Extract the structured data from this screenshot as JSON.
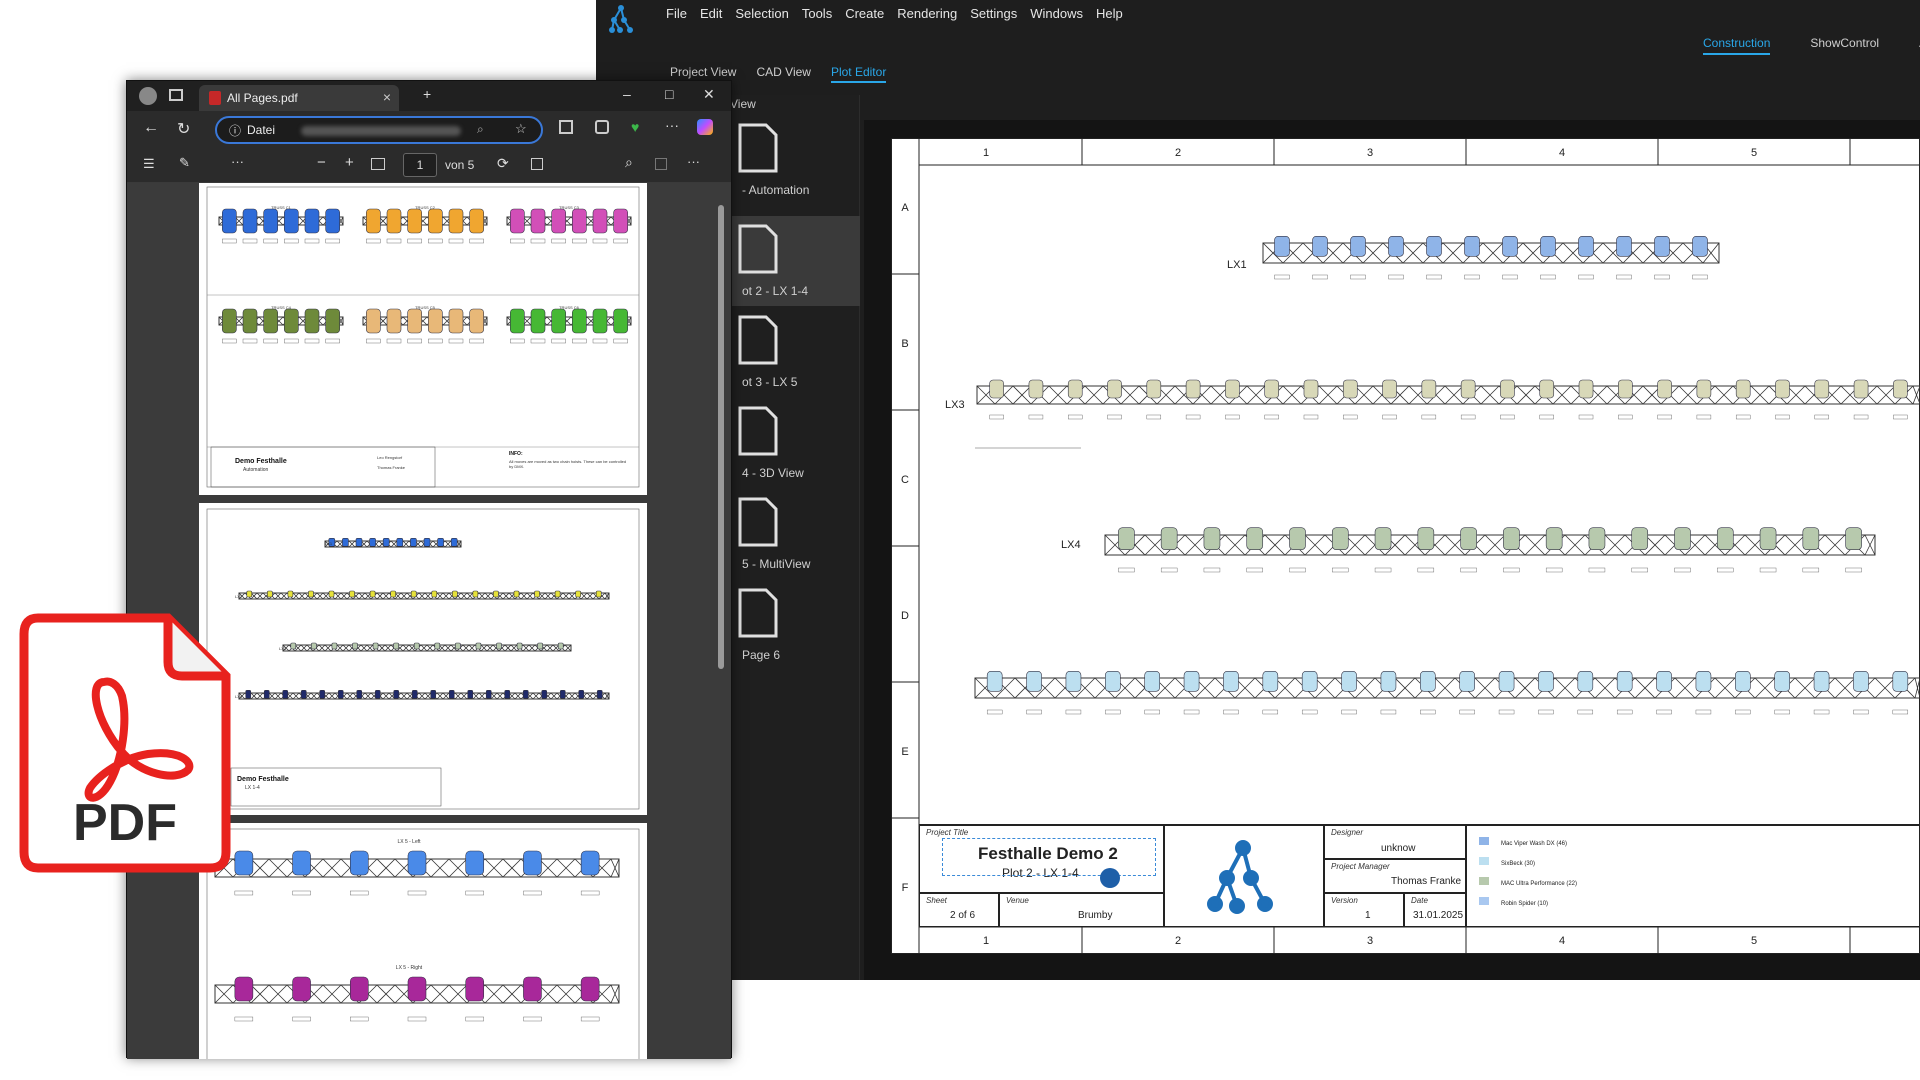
{
  "app": {
    "menu": [
      "File",
      "Edit",
      "Selection",
      "Tools",
      "Create",
      "Rendering",
      "Settings",
      "Windows",
      "Help"
    ],
    "mode_tabs": [
      "Construction",
      "ShowControl",
      "An"
    ],
    "active_mode": "Construction",
    "view_tabs": [
      "Project View",
      "CAD View",
      "Plot Editor"
    ],
    "active_view": "Plot Editor",
    "page_list_header": "View",
    "pages": [
      "- Automation",
      "ot 2 - LX 1-4",
      "ot 3 - LX 5",
      "4 - 3D View",
      "5 - MultiView",
      "Page 6"
    ],
    "selected_page": "ot 2 - LX 1-4"
  },
  "sheet": {
    "columns": [
      "1",
      "2",
      "3",
      "4",
      "5"
    ],
    "rows": [
      "A",
      "B",
      "C",
      "D",
      "E",
      "F"
    ],
    "trusses": [
      "LX1",
      "LX3",
      "LX4"
    ],
    "title_block": {
      "project_title_caption": "Project Title",
      "project_title": "Festhalle Demo 2",
      "project_subtitle": "Plot 2 - LX 1-4",
      "sheet_caption": "Sheet",
      "sheet_value": "2 of 6",
      "venue_caption": "Venue",
      "venue_value": "Brumby",
      "designer_caption": "Designer",
      "designer_value": "unknow",
      "pm_caption": "Project Manager",
      "pm_value": "Thomas Franke",
      "version_caption": "Version",
      "version_value": "1",
      "date_caption": "Date",
      "date_value": "31.01.2025",
      "legend": [
        {
          "label": "Mac Viper Wash DX (46)",
          "color": "#8fb4e8"
        },
        {
          "label": "SixBeck (30)",
          "color": "#bcdff0"
        },
        {
          "label": "MAC Ultra Performance (22)",
          "color": "#b7c9ad"
        },
        {
          "label": "Robin Spider (10)",
          "color": "#a9c8f0"
        }
      ]
    }
  },
  "pdf_viewer": {
    "tab_title": "All Pages.pdf",
    "address_prefix": "Datei",
    "page_current": "1",
    "page_total": "von 5",
    "page1": {
      "trusses": [
        "TRUSS C1",
        "TRUSS C2",
        "TRUSS C3",
        "TRUSS C4",
        "TRUSS C5",
        "TRUSS C6"
      ],
      "title": "Demo Festhalle",
      "subtitle": "Automation",
      "info_title": "INFO:",
      "info_text": "All moves are moved as two chain hoists. These can be controlled by DMX.",
      "pm": "Thomas Franke",
      "designer": "Leo Rengstorf"
    },
    "page2": {
      "title": "Demo Festhalle",
      "subtitle": "LX 1-4",
      "labels": [
        "LX1",
        "LX2",
        "LX3",
        "LX4"
      ]
    },
    "page3": {
      "labels": [
        "LX 5 - Left",
        "LX 5 - Right"
      ]
    }
  },
  "badge": {
    "text": "PDF",
    "color": "#e8221e"
  }
}
